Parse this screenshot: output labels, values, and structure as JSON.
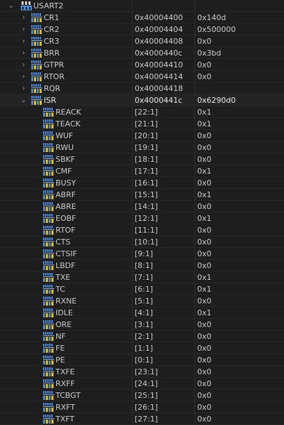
{
  "peripheral": {
    "name": "USART2",
    "expanded": true,
    "icon": "peripheral-icon"
  },
  "registers": [
    {
      "name": "CR1",
      "address": "0x40004400",
      "value": "0x140d",
      "expanded": false
    },
    {
      "name": "CR2",
      "address": "0x40004404",
      "value": "0x500000",
      "expanded": false
    },
    {
      "name": "CR3",
      "address": "0x40004408",
      "value": "0x0",
      "expanded": false
    },
    {
      "name": "BRR",
      "address": "0x4000440c",
      "value": "0x3bd",
      "expanded": false
    },
    {
      "name": "GTPR",
      "address": "0x40004410",
      "value": "0x0",
      "expanded": false
    },
    {
      "name": "RTOR",
      "address": "0x40004414",
      "value": "0x0",
      "expanded": false
    },
    {
      "name": "RQR",
      "address": "0x40004418",
      "value": "",
      "expanded": false
    },
    {
      "name": "ISR",
      "address": "0x4000441c",
      "value": "0x6290d0",
      "expanded": true,
      "selected": true
    }
  ],
  "isr_fields": [
    {
      "name": "REACK",
      "bits": "[22:1]",
      "value": "0x1"
    },
    {
      "name": "TEACK",
      "bits": "[21:1]",
      "value": "0x1"
    },
    {
      "name": "WUF",
      "bits": "[20:1]",
      "value": "0x0"
    },
    {
      "name": "RWU",
      "bits": "[19:1]",
      "value": "0x0"
    },
    {
      "name": "SBKF",
      "bits": "[18:1]",
      "value": "0x0"
    },
    {
      "name": "CMF",
      "bits": "[17:1]",
      "value": "0x1"
    },
    {
      "name": "BUSY",
      "bits": "[16:1]",
      "value": "0x0"
    },
    {
      "name": "ABRF",
      "bits": "[15:1]",
      "value": "0x1"
    },
    {
      "name": "ABRE",
      "bits": "[14:1]",
      "value": "0x0"
    },
    {
      "name": "EOBF",
      "bits": "[12:1]",
      "value": "0x1"
    },
    {
      "name": "RTOF",
      "bits": "[11:1]",
      "value": "0x0"
    },
    {
      "name": "CTS",
      "bits": "[10:1]",
      "value": "0x0"
    },
    {
      "name": "CTSIF",
      "bits": "[9:1]",
      "value": "0x0"
    },
    {
      "name": "LBDF",
      "bits": "[8:1]",
      "value": "0x0"
    },
    {
      "name": "TXE",
      "bits": "[7:1]",
      "value": "0x1"
    },
    {
      "name": "TC",
      "bits": "[6:1]",
      "value": "0x1"
    },
    {
      "name": "RXNE",
      "bits": "[5:1]",
      "value": "0x0"
    },
    {
      "name": "IDLE",
      "bits": "[4:1]",
      "value": "0x1"
    },
    {
      "name": "ORE",
      "bits": "[3:1]",
      "value": "0x0"
    },
    {
      "name": "NF",
      "bits": "[2:1]",
      "value": "0x0"
    },
    {
      "name": "FE",
      "bits": "[1:1]",
      "value": "0x0"
    },
    {
      "name": "PE",
      "bits": "[0:1]",
      "value": "0x0"
    },
    {
      "name": "TXFE",
      "bits": "[23:1]",
      "value": "0x0"
    },
    {
      "name": "RXFF",
      "bits": "[24:1]",
      "value": "0x0"
    },
    {
      "name": "TCBGT",
      "bits": "[25:1]",
      "value": "0x0"
    },
    {
      "name": "RXFT",
      "bits": "[26:1]",
      "value": "0x0"
    },
    {
      "name": "TXFT",
      "bits": "[27:1]",
      "value": "0x0"
    }
  ],
  "icons": {
    "register": "register-icon",
    "field": "field-icon",
    "expanded": "chevron-down-icon",
    "collapsed": "chevron-right-icon"
  },
  "colors": {
    "background": "#1e1e1e",
    "text": "#cccccc",
    "chevron": "#9a9a9a",
    "icon_blue": "#4a88d8",
    "icon_yellow": "#e8c000"
  }
}
